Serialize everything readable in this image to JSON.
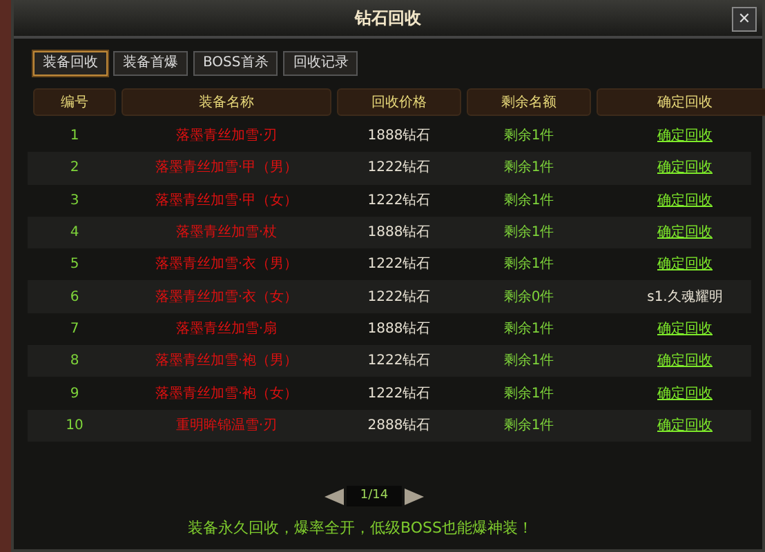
{
  "window": {
    "title": "钻石回收",
    "close": "✕"
  },
  "tabs": [
    {
      "label": "装备回收",
      "selected": true
    },
    {
      "label": "装备首爆",
      "selected": false
    },
    {
      "label": "BOSS首杀",
      "selected": false
    },
    {
      "label": "回收记录",
      "selected": false
    }
  ],
  "table": {
    "columns": [
      "编号",
      "装备名称",
      "回收价格",
      "剩余名额",
      "确定回收"
    ],
    "rows": [
      {
        "no": "1",
        "name": "落墨青丝加雪·刃",
        "price": "1888钻石",
        "remaining": "剩余1件",
        "action": {
          "kind": "link",
          "text": "确定回收"
        }
      },
      {
        "no": "2",
        "name": "落墨青丝加雪·甲（男）",
        "price": "1222钻石",
        "remaining": "剩余1件",
        "action": {
          "kind": "link",
          "text": "确定回收"
        }
      },
      {
        "no": "3",
        "name": "落墨青丝加雪·甲（女）",
        "price": "1222钻石",
        "remaining": "剩余1件",
        "action": {
          "kind": "link",
          "text": "确定回收"
        }
      },
      {
        "no": "4",
        "name": "落墨青丝加雪·杖",
        "price": "1888钻石",
        "remaining": "剩余1件",
        "action": {
          "kind": "link",
          "text": "确定回收"
        }
      },
      {
        "no": "5",
        "name": "落墨青丝加雪·衣（男）",
        "price": "1222钻石",
        "remaining": "剩余1件",
        "action": {
          "kind": "link",
          "text": "确定回收"
        }
      },
      {
        "no": "6",
        "name": "落墨青丝加雪·衣（女）",
        "price": "1222钻石",
        "remaining": "剩余0件",
        "action": {
          "kind": "text",
          "text": "s1.久魂耀明"
        }
      },
      {
        "no": "7",
        "name": "落墨青丝加雪·扇",
        "price": "1888钻石",
        "remaining": "剩余1件",
        "action": {
          "kind": "link",
          "text": "确定回收"
        }
      },
      {
        "no": "8",
        "name": "落墨青丝加雪·袍（男）",
        "price": "1222钻石",
        "remaining": "剩余1件",
        "action": {
          "kind": "link",
          "text": "确定回收"
        }
      },
      {
        "no": "9",
        "name": "落墨青丝加雪·袍（女）",
        "price": "1222钻石",
        "remaining": "剩余1件",
        "action": {
          "kind": "link",
          "text": "确定回收"
        }
      },
      {
        "no": "10",
        "name": "重明眸锦温雪·刃",
        "price": "2888钻石",
        "remaining": "剩余1件",
        "action": {
          "kind": "link",
          "text": "确定回收"
        }
      }
    ]
  },
  "pager": {
    "page": "1/14"
  },
  "footer": "装备永久回收，爆率全开，低级BOSS也能爆神装！"
}
